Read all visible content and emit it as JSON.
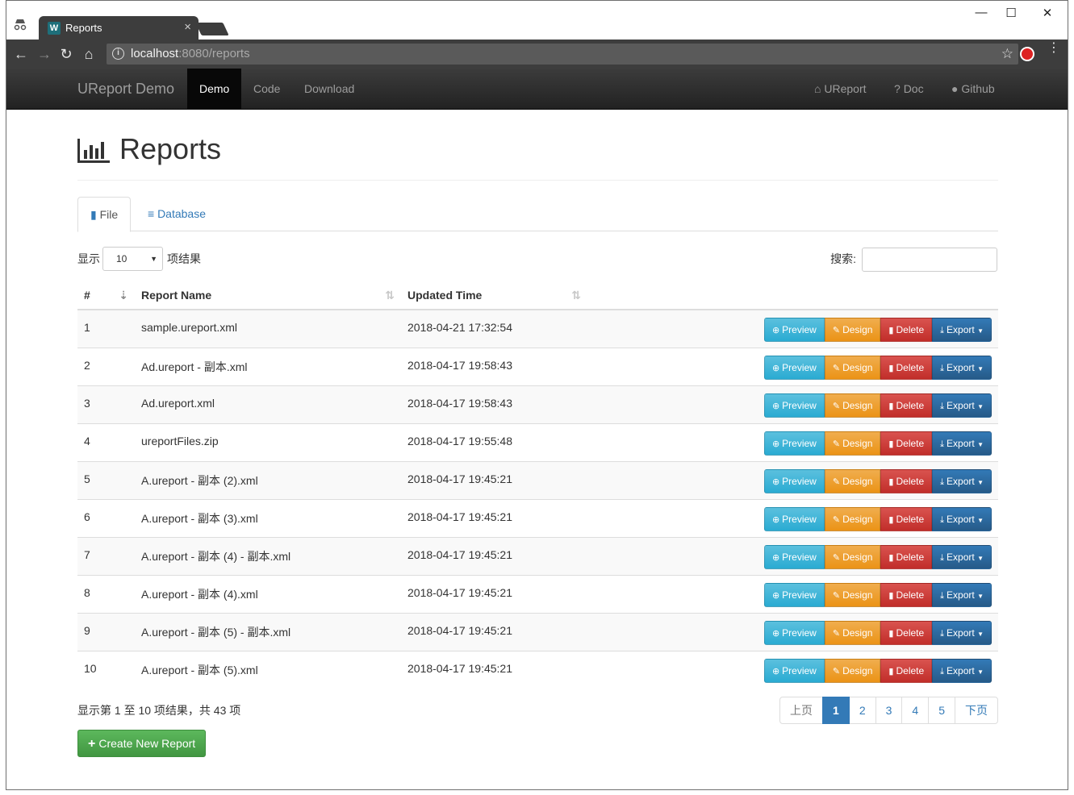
{
  "browser": {
    "tab_title": "Reports",
    "tab_close": "×",
    "favicon_letter": "W",
    "url_host": "localhost",
    "url_rest": ":8080/reports",
    "min": "—",
    "max": "☐",
    "close": "✕",
    "back": "←",
    "forward": "→",
    "reload": "↻",
    "home": "⌂",
    "star": "☆",
    "info_icon": "i",
    "menu_icon": "⋮"
  },
  "navbar": {
    "brand": "UReport Demo",
    "items": [
      {
        "label": "Demo",
        "active": true
      },
      {
        "label": "Code"
      },
      {
        "label": "Download"
      }
    ],
    "right": [
      {
        "label": "UReport",
        "icon": "home-icon",
        "glyph": "⌂"
      },
      {
        "label": "Doc",
        "icon": "question-circle-icon",
        "glyph": "?"
      },
      {
        "label": "Github",
        "icon": "github-icon",
        "glyph": "●"
      }
    ]
  },
  "header": {
    "title": "Reports"
  },
  "tabs": [
    {
      "label": "File",
      "active": true,
      "icon": "file-icon"
    },
    {
      "label": "Database",
      "icon": "database-icon"
    }
  ],
  "table_controls": {
    "show_label": "显示",
    "page_size": "10",
    "after_label": "项结果",
    "search_label": "搜索:"
  },
  "table": {
    "columns": [
      "#",
      "Report Name",
      "Updated Time"
    ],
    "rows": [
      {
        "n": "1",
        "name": "sample.ureport.xml",
        "time": "2018-04-21 17:32:54"
      },
      {
        "n": "2",
        "name": "Ad.ureport - 副本.xml",
        "time": "2018-04-17 19:58:43"
      },
      {
        "n": "3",
        "name": "Ad.ureport.xml",
        "time": "2018-04-17 19:58:43"
      },
      {
        "n": "4",
        "name": "ureportFiles.zip",
        "time": "2018-04-17 19:55:48"
      },
      {
        "n": "5",
        "name": "A.ureport - 副本 (2).xml",
        "time": "2018-04-17 19:45:21"
      },
      {
        "n": "6",
        "name": "A.ureport - 副本 (3).xml",
        "time": "2018-04-17 19:45:21"
      },
      {
        "n": "7",
        "name": "A.ureport - 副本 (4) - 副本.xml",
        "time": "2018-04-17 19:45:21"
      },
      {
        "n": "8",
        "name": "A.ureport - 副本 (4).xml",
        "time": "2018-04-17 19:45:21"
      },
      {
        "n": "9",
        "name": "A.ureport - 副本 (5) - 副本.xml",
        "time": "2018-04-17 19:45:21"
      },
      {
        "n": "10",
        "name": "A.ureport - 副本 (5).xml",
        "time": "2018-04-17 19:45:21"
      }
    ],
    "actions": {
      "preview": "Preview",
      "design": "Design",
      "delete": "Delete",
      "export": "Export"
    }
  },
  "footer": {
    "info": "显示第 1 至 10 项结果，共 43 项",
    "pager": [
      "上页",
      "1",
      "2",
      "3",
      "4",
      "5",
      "下页"
    ],
    "current_page": "1",
    "create_label": "Create New Report"
  },
  "colors": {
    "info": "#5bc0de",
    "warning": "#f0ad4e",
    "danger": "#d9534f",
    "primary": "#337ab7",
    "success": "#5cb85c"
  }
}
